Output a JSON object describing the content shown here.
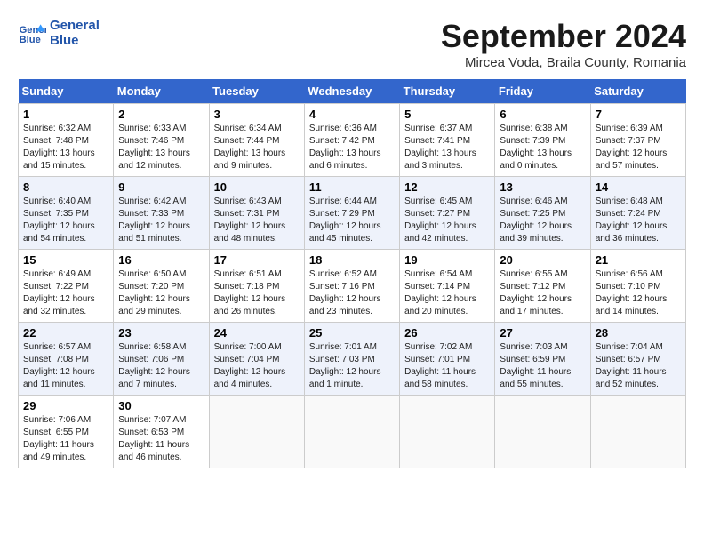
{
  "header": {
    "logo_line1": "General",
    "logo_line2": "Blue",
    "month_title": "September 2024",
    "location": "Mircea Voda, Braila County, Romania"
  },
  "weekdays": [
    "Sunday",
    "Monday",
    "Tuesday",
    "Wednesday",
    "Thursday",
    "Friday",
    "Saturday"
  ],
  "weeks": [
    [
      {
        "day": "1",
        "sunrise": "6:32 AM",
        "sunset": "7:48 PM",
        "daylight": "13 hours and 15 minutes."
      },
      {
        "day": "2",
        "sunrise": "6:33 AM",
        "sunset": "7:46 PM",
        "daylight": "13 hours and 12 minutes."
      },
      {
        "day": "3",
        "sunrise": "6:34 AM",
        "sunset": "7:44 PM",
        "daylight": "13 hours and 9 minutes."
      },
      {
        "day": "4",
        "sunrise": "6:36 AM",
        "sunset": "7:42 PM",
        "daylight": "13 hours and 6 minutes."
      },
      {
        "day": "5",
        "sunrise": "6:37 AM",
        "sunset": "7:41 PM",
        "daylight": "13 hours and 3 minutes."
      },
      {
        "day": "6",
        "sunrise": "6:38 AM",
        "sunset": "7:39 PM",
        "daylight": "13 hours and 0 minutes."
      },
      {
        "day": "7",
        "sunrise": "6:39 AM",
        "sunset": "7:37 PM",
        "daylight": "12 hours and 57 minutes."
      }
    ],
    [
      {
        "day": "8",
        "sunrise": "6:40 AM",
        "sunset": "7:35 PM",
        "daylight": "12 hours and 54 minutes."
      },
      {
        "day": "9",
        "sunrise": "6:42 AM",
        "sunset": "7:33 PM",
        "daylight": "12 hours and 51 minutes."
      },
      {
        "day": "10",
        "sunrise": "6:43 AM",
        "sunset": "7:31 PM",
        "daylight": "12 hours and 48 minutes."
      },
      {
        "day": "11",
        "sunrise": "6:44 AM",
        "sunset": "7:29 PM",
        "daylight": "12 hours and 45 minutes."
      },
      {
        "day": "12",
        "sunrise": "6:45 AM",
        "sunset": "7:27 PM",
        "daylight": "12 hours and 42 minutes."
      },
      {
        "day": "13",
        "sunrise": "6:46 AM",
        "sunset": "7:25 PM",
        "daylight": "12 hours and 39 minutes."
      },
      {
        "day": "14",
        "sunrise": "6:48 AM",
        "sunset": "7:24 PM",
        "daylight": "12 hours and 36 minutes."
      }
    ],
    [
      {
        "day": "15",
        "sunrise": "6:49 AM",
        "sunset": "7:22 PM",
        "daylight": "12 hours and 32 minutes."
      },
      {
        "day": "16",
        "sunrise": "6:50 AM",
        "sunset": "7:20 PM",
        "daylight": "12 hours and 29 minutes."
      },
      {
        "day": "17",
        "sunrise": "6:51 AM",
        "sunset": "7:18 PM",
        "daylight": "12 hours and 26 minutes."
      },
      {
        "day": "18",
        "sunrise": "6:52 AM",
        "sunset": "7:16 PM",
        "daylight": "12 hours and 23 minutes."
      },
      {
        "day": "19",
        "sunrise": "6:54 AM",
        "sunset": "7:14 PM",
        "daylight": "12 hours and 20 minutes."
      },
      {
        "day": "20",
        "sunrise": "6:55 AM",
        "sunset": "7:12 PM",
        "daylight": "12 hours and 17 minutes."
      },
      {
        "day": "21",
        "sunrise": "6:56 AM",
        "sunset": "7:10 PM",
        "daylight": "12 hours and 14 minutes."
      }
    ],
    [
      {
        "day": "22",
        "sunrise": "6:57 AM",
        "sunset": "7:08 PM",
        "daylight": "12 hours and 11 minutes."
      },
      {
        "day": "23",
        "sunrise": "6:58 AM",
        "sunset": "7:06 PM",
        "daylight": "12 hours and 7 minutes."
      },
      {
        "day": "24",
        "sunrise": "7:00 AM",
        "sunset": "7:04 PM",
        "daylight": "12 hours and 4 minutes."
      },
      {
        "day": "25",
        "sunrise": "7:01 AM",
        "sunset": "7:03 PM",
        "daylight": "12 hours and 1 minute."
      },
      {
        "day": "26",
        "sunrise": "7:02 AM",
        "sunset": "7:01 PM",
        "daylight": "11 hours and 58 minutes."
      },
      {
        "day": "27",
        "sunrise": "7:03 AM",
        "sunset": "6:59 PM",
        "daylight": "11 hours and 55 minutes."
      },
      {
        "day": "28",
        "sunrise": "7:04 AM",
        "sunset": "6:57 PM",
        "daylight": "11 hours and 52 minutes."
      }
    ],
    [
      {
        "day": "29",
        "sunrise": "7:06 AM",
        "sunset": "6:55 PM",
        "daylight": "11 hours and 49 minutes."
      },
      {
        "day": "30",
        "sunrise": "7:07 AM",
        "sunset": "6:53 PM",
        "daylight": "11 hours and 46 minutes."
      },
      null,
      null,
      null,
      null,
      null
    ]
  ]
}
